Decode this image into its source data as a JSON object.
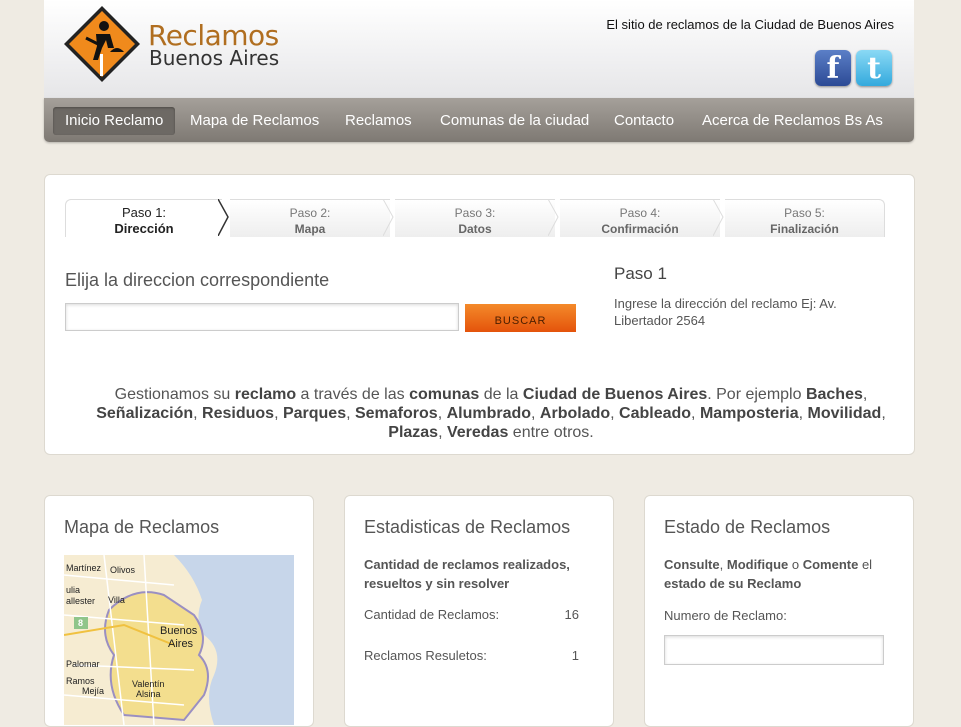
{
  "header": {
    "brand_line1": "Reclamos",
    "brand_line2": "Buenos Aires",
    "tagline": "El sitio de reclamos de la Ciudad de Buenos Aires",
    "facebook_glyph": "f",
    "twitter_glyph": "t"
  },
  "nav": {
    "items": [
      {
        "label": "Inicio Reclamo"
      },
      {
        "label": "Mapa de Reclamos"
      },
      {
        "label": "Reclamos"
      },
      {
        "label": "Comunas de la ciudad"
      },
      {
        "label": "Contacto"
      },
      {
        "label": "Acerca de Reclamos Bs As"
      }
    ],
    "active_index": 0
  },
  "steps": [
    {
      "num": "Paso 1:",
      "name": "Dirección"
    },
    {
      "num": "Paso 2:",
      "name": "Mapa"
    },
    {
      "num": "Paso 3:",
      "name": "Datos"
    },
    {
      "num": "Paso 4:",
      "name": "Confirmación"
    },
    {
      "num": "Paso 5:",
      "name": "Finalización"
    }
  ],
  "search": {
    "heading": "Elija la direccion correspondiente",
    "value": "",
    "button": "BUSCAR"
  },
  "paso": {
    "title": "Paso 1",
    "description": "Ingrese la dirección del reclamo Ej: Av. Libertador 2564"
  },
  "gestionamos": {
    "t1": "Gestionamos su ",
    "b1": "reclamo",
    "t2": " a través de las ",
    "b2": "comunas",
    "t3": " de la ",
    "b3": "Ciudad de Buenos Aires",
    "t4": ". Por ejemplo ",
    "list": [
      "Baches",
      "Señalización",
      "Residuos",
      "Parques",
      "Semaforos",
      "Alumbrado",
      "Arbolado",
      "Cableado",
      "Mamposteria",
      "Movilidad",
      "Plazas",
      "Veredas"
    ],
    "sep": ", ",
    "tail": " entre otros."
  },
  "map_box": {
    "title": "Mapa de Reclamos",
    "labels": [
      "Martínez",
      "Olivos",
      "ulia",
      "allester",
      "Villa",
      "Buenos",
      "Aires",
      "Palomar",
      "Ramos",
      "Mejía",
      "Valentín",
      "Alsina",
      "8"
    ]
  },
  "stats_box": {
    "title": "Estadisticas de Reclamos",
    "subtitle": "Cantidad de reclamos realizados, resueltos y sin resolver",
    "rows": [
      {
        "label": "Cantidad de Reclamos:",
        "value": "16"
      },
      {
        "label": "Reclamos Resuletos:",
        "value": "1"
      }
    ]
  },
  "estado_box": {
    "title": "Estado de Reclamos",
    "b1": "Consulte",
    "t1": ", ",
    "b2": "Modifique",
    "t2": " o ",
    "b3": "Comente",
    "t3": " el ",
    "b4": "estado de su Reclamo",
    "field_label": "Numero de Reclamo:",
    "value": ""
  },
  "colors": {
    "brand_orange": "#b06e20",
    "button_orange": "#f06a1a",
    "nav_gray": "#8f8a84",
    "page_bg": "#efebe3"
  }
}
